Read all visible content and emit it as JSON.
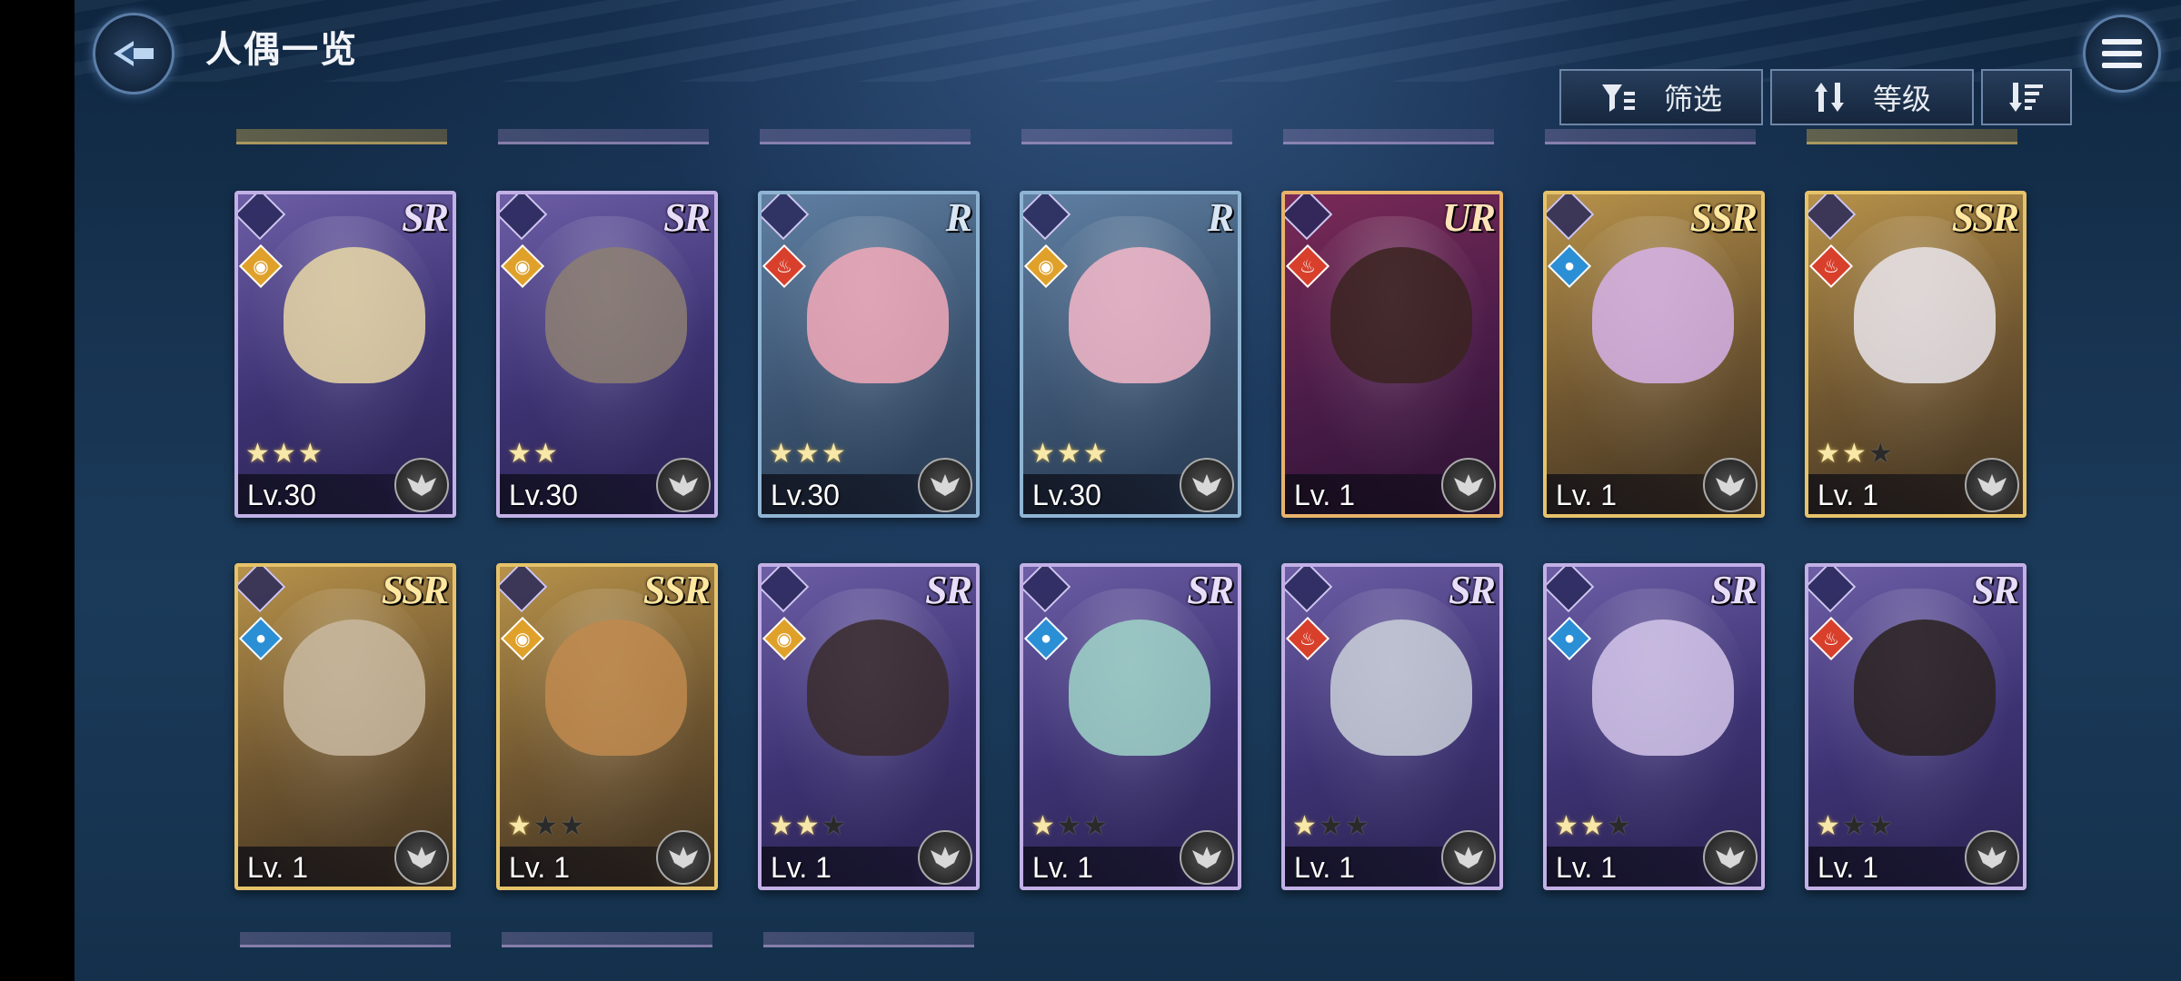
{
  "header": {
    "title": "人偶一览",
    "back_icon": "back-arrow-icon",
    "menu_icon": "hamburger-menu-icon"
  },
  "toolbar": {
    "filter_label": "筛选",
    "sort_label": "等级",
    "filter_icon": "filter-icon",
    "sort_icon": "sort-arrows-icon",
    "order_icon": "sort-order-icon"
  },
  "cards": [
    {
      "rarity": "SR",
      "element": "light",
      "stars": 3,
      "max_stars": 3,
      "level": "Lv.30"
    },
    {
      "rarity": "SR",
      "element": "light",
      "stars": 2,
      "max_stars": 2,
      "level": "Lv.30"
    },
    {
      "rarity": "R",
      "element": "fire",
      "stars": 3,
      "max_stars": 3,
      "level": "Lv.30"
    },
    {
      "rarity": "R",
      "element": "light",
      "stars": 3,
      "max_stars": 3,
      "level": "Lv.30"
    },
    {
      "rarity": "UR",
      "element": "fire",
      "stars": 0,
      "max_stars": 0,
      "level": "Lv. 1"
    },
    {
      "rarity": "SSR",
      "element": "water",
      "stars": 0,
      "max_stars": 0,
      "level": "Lv. 1"
    },
    {
      "rarity": "SSR",
      "element": "fire",
      "stars": 2,
      "max_stars": 3,
      "level": "Lv. 1"
    },
    {
      "rarity": "SSR",
      "element": "water",
      "stars": 0,
      "max_stars": 0,
      "level": "Lv. 1"
    },
    {
      "rarity": "SSR",
      "element": "light",
      "stars": 1,
      "max_stars": 3,
      "level": "Lv. 1"
    },
    {
      "rarity": "SR",
      "element": "light",
      "stars": 2,
      "max_stars": 3,
      "level": "Lv. 1"
    },
    {
      "rarity": "SR",
      "element": "water",
      "stars": 1,
      "max_stars": 3,
      "level": "Lv. 1"
    },
    {
      "rarity": "SR",
      "element": "fire",
      "stars": 1,
      "max_stars": 3,
      "level": "Lv. 1"
    },
    {
      "rarity": "SR",
      "element": "water",
      "stars": 2,
      "max_stars": 3,
      "level": "Lv. 1"
    },
    {
      "rarity": "SR",
      "element": "fire",
      "stars": 1,
      "max_stars": 3,
      "level": "Lv. 1"
    }
  ],
  "colors": {
    "hair": [
      "#e8d7a6",
      "#8c7f72",
      "#f2a9b8",
      "#f3b6c8",
      "#3a2320",
      "#d6b2e8",
      "#e9e4ea",
      "#c9b9a0",
      "#c08a4e",
      "#3a2b2b",
      "#9fd3c8",
      "#c9cfd8",
      "#d4c6ea",
      "#2a2220"
    ]
  }
}
